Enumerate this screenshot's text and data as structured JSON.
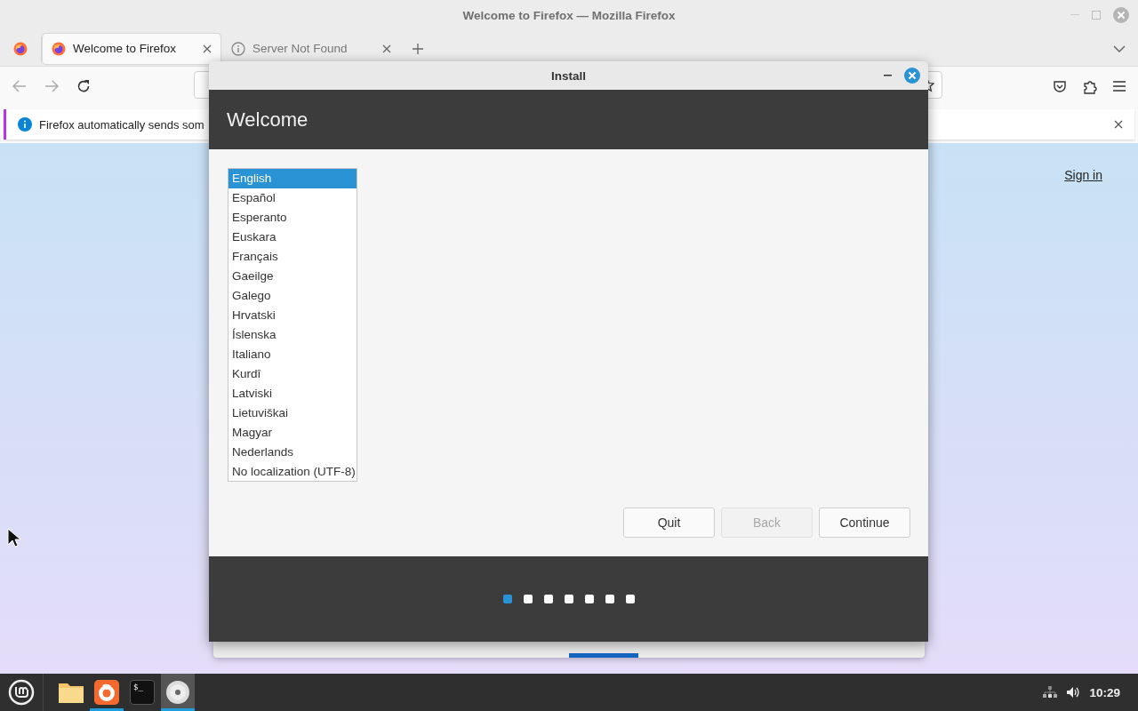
{
  "firefox": {
    "window_title": "Welcome to Firefox — Mozilla Firefox",
    "tabs": [
      {
        "label": "Welcome to Firefox",
        "selected": true
      },
      {
        "label": "Server Not Found",
        "selected": false
      }
    ],
    "notification": "Firefox automatically sends som",
    "sign_in": "Sign in"
  },
  "installer": {
    "title": "Install",
    "heading": "Welcome",
    "languages": [
      {
        "label": "English",
        "selected": true
      },
      {
        "label": "Español",
        "selected": false
      },
      {
        "label": "Esperanto",
        "selected": false
      },
      {
        "label": "Euskara",
        "selected": false
      },
      {
        "label": "Français",
        "selected": false
      },
      {
        "label": "Gaeilge",
        "selected": false
      },
      {
        "label": "Galego",
        "selected": false
      },
      {
        "label": "Hrvatski",
        "selected": false
      },
      {
        "label": "Íslenska",
        "selected": false
      },
      {
        "label": "Italiano",
        "selected": false
      },
      {
        "label": "Kurdî",
        "selected": false
      },
      {
        "label": "Latviski",
        "selected": false
      },
      {
        "label": "Lietuviškai",
        "selected": false
      },
      {
        "label": "Magyar",
        "selected": false
      },
      {
        "label": "Nederlands",
        "selected": false
      },
      {
        "label": "No localization (UTF-8)",
        "selected": false
      }
    ],
    "buttons": [
      {
        "label": "Quit",
        "disabled": false
      },
      {
        "label": "Back",
        "disabled": true
      },
      {
        "label": "Continue",
        "disabled": false
      }
    ],
    "steps": [
      {
        "selected": true
      },
      {
        "selected": false
      },
      {
        "selected": false
      },
      {
        "selected": false
      },
      {
        "selected": false
      },
      {
        "selected": false
      },
      {
        "selected": false
      }
    ]
  },
  "taskbar": {
    "apps": [
      {
        "kind": "files",
        "running": false,
        "focused": false
      },
      {
        "kind": "firefox",
        "running": true,
        "focused": false
      },
      {
        "kind": "terminal",
        "label": "$_",
        "running": false,
        "focused": false
      },
      {
        "kind": "disc",
        "running": true,
        "focused": true
      }
    ],
    "clock": "10:29"
  }
}
